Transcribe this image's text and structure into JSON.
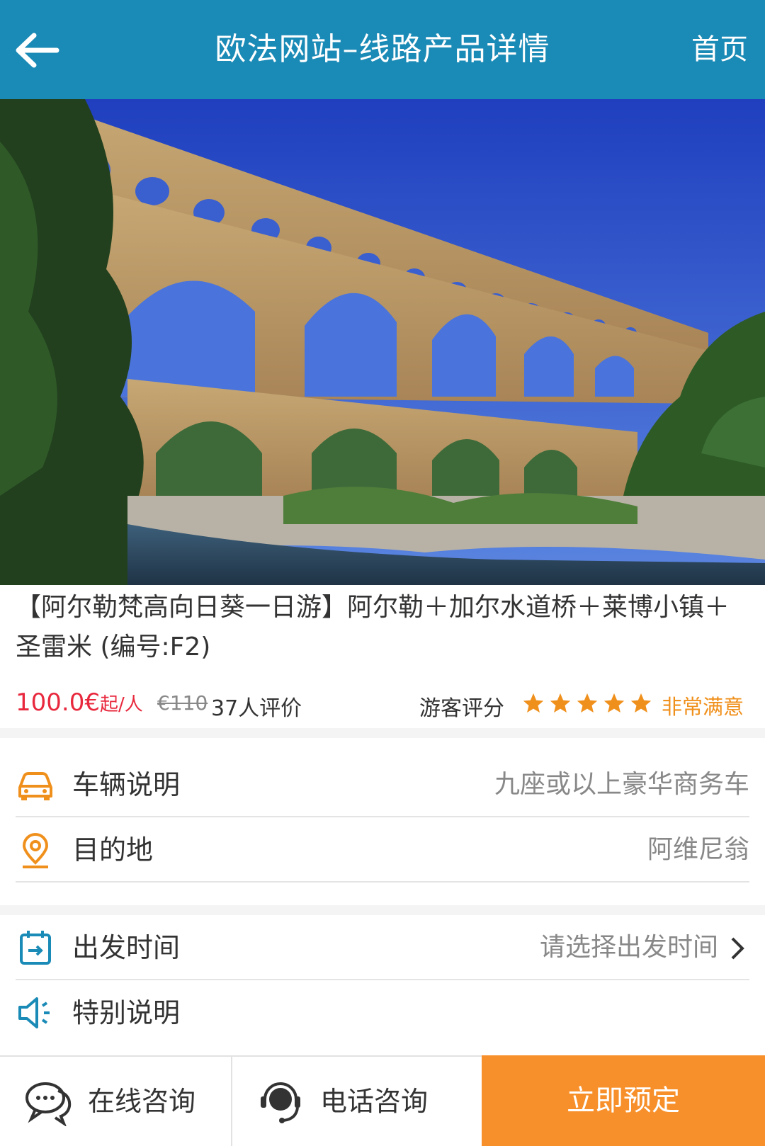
{
  "header": {
    "title": "欧法网站–线路产品详情",
    "home_label": "首页",
    "bg_color": "#1a8ab6"
  },
  "product": {
    "title": "【阿尔勒梵高向日葵一日游】阿尔勒＋加尔水道桥＋莱博小镇＋圣雷米 (编号:F2)",
    "price": "100.0€",
    "price_unit": "起/人",
    "original_price": "€110",
    "review_count": "37人评价",
    "rating_label": "游客评分",
    "stars": 5,
    "rating_text": "非常满意",
    "price_color": "#e8283d",
    "accent_color": "#f0901c"
  },
  "details": {
    "vehicle": {
      "label": "车辆说明",
      "value": "九座或以上豪华商务车",
      "icon": "car-icon"
    },
    "destination": {
      "label": "目的地",
      "value": "阿维尼翁",
      "icon": "location-pin-icon"
    }
  },
  "options": {
    "departure": {
      "label": "出发时间",
      "value": "请选择出发时间",
      "icon": "calendar-icon"
    },
    "special": {
      "label": "特别说明",
      "icon": "speaker-icon"
    }
  },
  "bottom_bar": {
    "online": "在线咨询",
    "phone": "电话咨询",
    "book": "立即预定",
    "book_color": "#f7902a"
  }
}
